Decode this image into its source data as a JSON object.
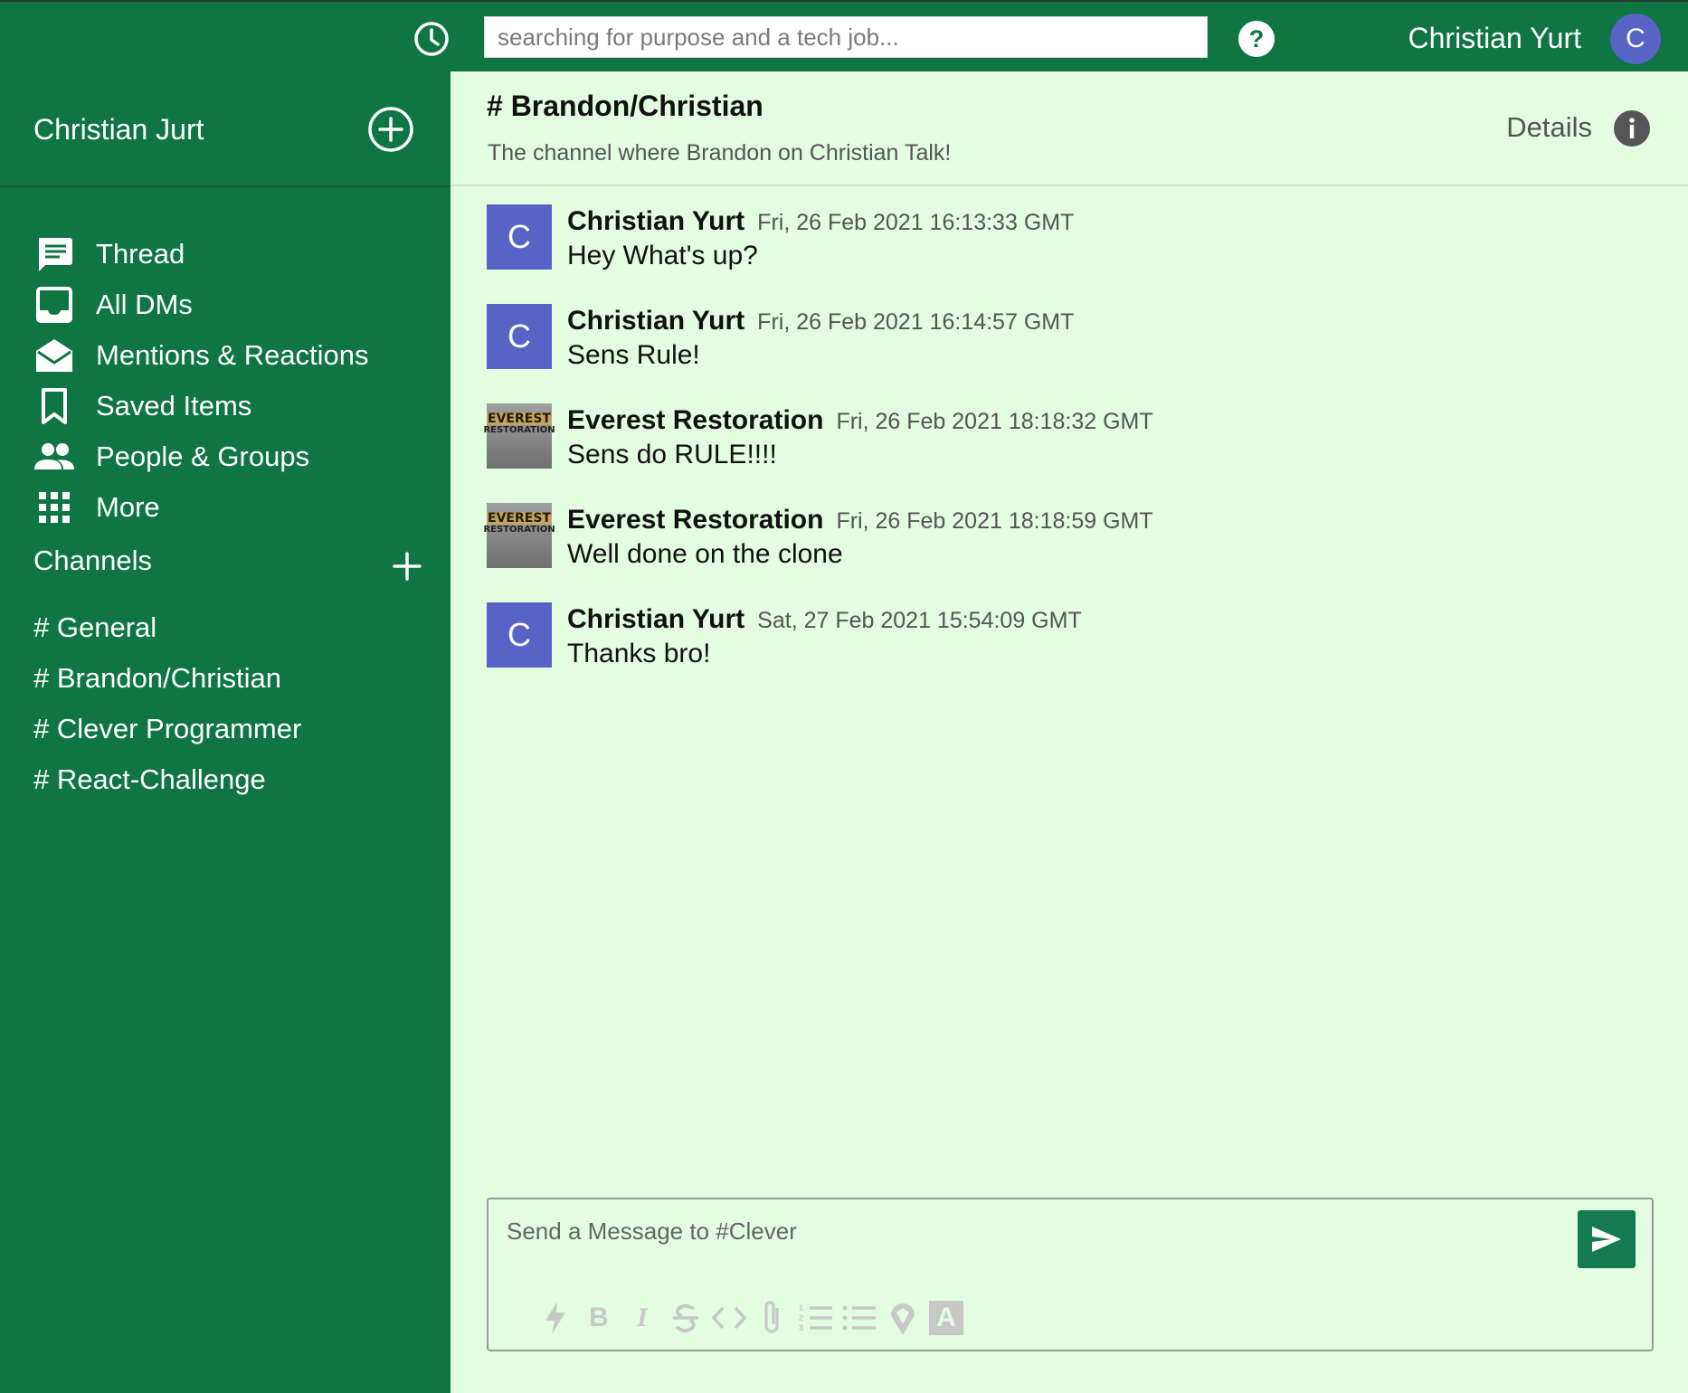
{
  "header": {
    "search_placeholder": "searching for purpose and a tech job...",
    "user_name": "Christian Yurt",
    "avatar_letter": "C"
  },
  "sidebar": {
    "workspace_name": "Christian Jurt",
    "nav": [
      {
        "label": "Thread",
        "icon": "message-square-icon"
      },
      {
        "label": "All DMs",
        "icon": "inbox-icon"
      },
      {
        "label": "Mentions & Reactions",
        "icon": "open-envelope-icon"
      },
      {
        "label": "Saved Items",
        "icon": "bookmark-icon"
      },
      {
        "label": "People & Groups",
        "icon": "people-icon"
      },
      {
        "label": "More",
        "icon": "apps-grid-icon"
      }
    ],
    "channels_label": "Channels",
    "channels": [
      "# General",
      "# Brandon/Christian",
      "# Clever Programmer",
      "# React-Challenge"
    ]
  },
  "channel": {
    "title": "# Brandon/Christian",
    "description": "The channel where Brandon on Christian Talk!",
    "details_label": "Details"
  },
  "messages": [
    {
      "user": "Christian Yurt",
      "time": "Fri, 26 Feb 2021 16:13:33 GMT",
      "text": "Hey What's up?",
      "avatar_letter": "C"
    },
    {
      "user": "Christian Yurt",
      "time": "Fri, 26 Feb 2021 16:14:57 GMT",
      "text": "Sens Rule!",
      "avatar_letter": "C"
    },
    {
      "user": "Everest Restoration",
      "time": "Fri, 26 Feb 2021 18:18:32 GMT",
      "text": "Sens do RULE!!!!",
      "avatar_line1": "EVEREST",
      "avatar_line2": "RESTORATION"
    },
    {
      "user": "Everest Restoration",
      "time": "Fri, 26 Feb 2021 18:18:59 GMT",
      "text": "Well done on the clone",
      "avatar_line1": "EVEREST",
      "avatar_line2": "RESTORATION"
    },
    {
      "user": "Christian Yurt",
      "time": "Sat, 27 Feb 2021 15:54:09 GMT",
      "text": "Thanks bro!",
      "avatar_letter": "C"
    }
  ],
  "composer": {
    "placeholder": "Send a Message to #Clever",
    "toolbar": [
      "lightning-icon",
      "bold-icon",
      "italic-icon",
      "strikethrough-icon",
      "code-icon",
      "paperclip-icon",
      "numbered-list-icon",
      "bulleted-list-icon",
      "map-pin-icon",
      "text-format-icon"
    ],
    "bold_glyph": "B",
    "italic_glyph": "I",
    "format_glyph": "A"
  },
  "colors": {
    "sidebar_bg": "#0e7543",
    "chat_bg": "#e2fde0",
    "avatar": "#5763c5",
    "send_button": "#147a4f"
  }
}
